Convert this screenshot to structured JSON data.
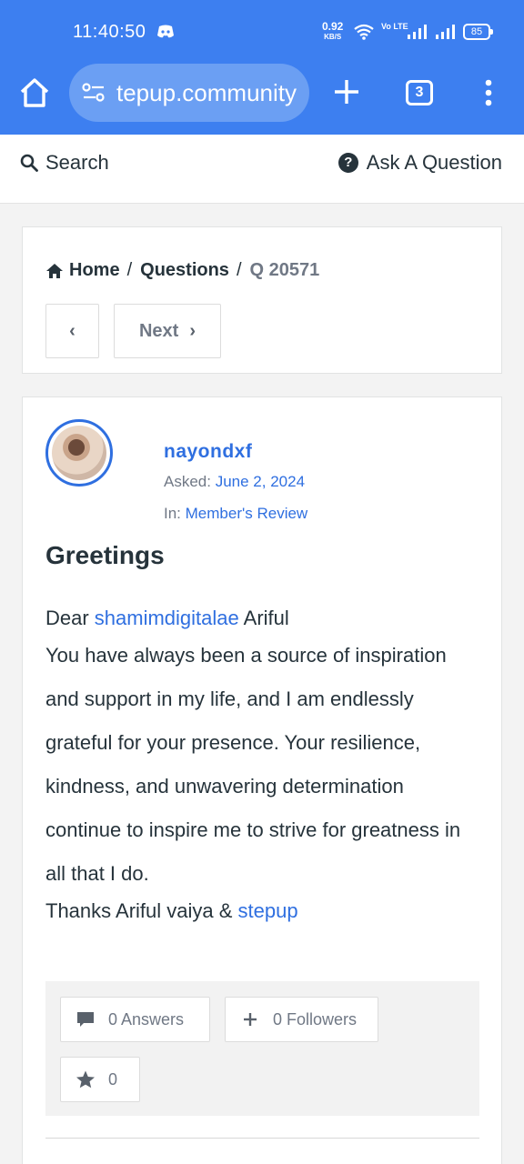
{
  "status_bar": {
    "time": "11:40:50",
    "net_speed": "0.92",
    "net_unit": "KB/S",
    "volte": "Vo LTE",
    "battery": "85"
  },
  "browser": {
    "url": "tepup.community",
    "tab_count": "3"
  },
  "topbar": {
    "search_label": "Search",
    "ask_label": "Ask A Question"
  },
  "breadcrumb": {
    "home": "Home",
    "sep": "/",
    "questions": "Questions",
    "current": "Q 20571"
  },
  "pager": {
    "prev_icon": "‹",
    "next_label": "Next",
    "next_icon": "›"
  },
  "question": {
    "author": "nayondxf",
    "asked_label": "Asked:",
    "asked_date": "June 2, 2024",
    "in_label": "In:",
    "category": "Member's Review",
    "title": "Greetings",
    "body": {
      "dear": "Dear ",
      "mention": "shamimdigitalae",
      "dear_rest": " Ariful",
      "paragraph": "You have always been a source of inspiration and support in my life, and I am endlessly grateful for your presence. Your resilience, kindness, and unwavering determination continue to inspire me to strive for greatness in all that I do.",
      "thanks": "Thanks Ariful vaiya & ",
      "link": "stepup"
    }
  },
  "stats": {
    "answers": "0 Answers",
    "followers": "0 Followers",
    "favorites": "0"
  },
  "colors": {
    "browser_bar": "#3d7ff0",
    "link": "#2f6fe0",
    "text": "#26333b",
    "muted": "#707885"
  }
}
